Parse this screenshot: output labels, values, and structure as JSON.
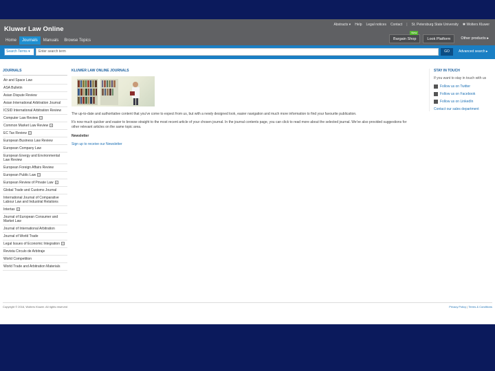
{
  "header": {
    "logo": "Kluwer Law Online",
    "nav_tabs": [
      "Home",
      "Journals",
      "Manuals",
      "Browse Topics"
    ],
    "active_tab": "Journals",
    "util_links": [
      "Abstracts ▾",
      "Help",
      "Legal notices",
      "Contact"
    ],
    "institution": "St. Petersburg State University",
    "publisher_logo": "Wolters Kluwer",
    "bargain_shop": "Bargain Shop",
    "new_badge": "New",
    "look_platform": "Look Platform",
    "other_products": "Other products ▸"
  },
  "search": {
    "scope": "Search Terms ▾",
    "placeholder": "Enter search term",
    "go": "GO",
    "advanced": "Advanced search ▸"
  },
  "sidebar": {
    "title": "JOURNALS",
    "items": [
      {
        "label": "Air and Space Law",
        "plus": false
      },
      {
        "label": "ASA Bulletin",
        "plus": false
      },
      {
        "label": "Asian Dispute Review",
        "plus": false
      },
      {
        "label": "Asian International Arbitration Journal",
        "plus": false
      },
      {
        "label": "ICSID International Arbitration Review",
        "plus": false
      },
      {
        "label": "Computer Law Review",
        "plus": true
      },
      {
        "label": "Common Market Law Review",
        "plus": true
      },
      {
        "label": "EC Tax Review",
        "plus": true
      },
      {
        "label": "European Business Law Review",
        "plus": false
      },
      {
        "label": "European Company Law",
        "plus": false
      },
      {
        "label": "European Energy and Environmental Law Review",
        "plus": false
      },
      {
        "label": "European Foreign Affairs Review",
        "plus": false
      },
      {
        "label": "European Public Law",
        "plus": true
      },
      {
        "label": "European Review of Private Law",
        "plus": true
      },
      {
        "label": "Global Trade and Customs Journal",
        "plus": false
      },
      {
        "label": "International Journal of Comparative Labour Law and Industrial Relations",
        "plus": false
      },
      {
        "label": "Intertax",
        "plus": true
      },
      {
        "label": "Journal of European Consumer and Market Law",
        "plus": false
      },
      {
        "label": "Journal of International Arbitration",
        "plus": false
      },
      {
        "label": "Journal of World Trade",
        "plus": false
      },
      {
        "label": "Legal Issues of Economic Integration",
        "plus": true
      },
      {
        "label": "Revista Circulo de Arbitraje",
        "plus": false
      },
      {
        "label": "World Competition",
        "plus": false
      },
      {
        "label": "World Trade and Arbitration Materials",
        "plus": false
      }
    ]
  },
  "main": {
    "title": "KLUWER LAW ONLINE JOURNALS",
    "para1": "The up-to-date and authoritative content that you've come to expect from us, but with a newly designed look, easier navigation and much more information to find your favourite publication.",
    "para2": "It's now much quicker and easier to browse straight to the most recent article of your chosen journal. In the journal contents page, you can click to read more about the selected journal. We've also provided suggestions for other relevant articles on the same topic area.",
    "newsletter_heading": "Newsletter",
    "newsletter_link": "Sign up to receive our Newsletter"
  },
  "right": {
    "title": "STAY IN TOUCH",
    "text": "If you want to stay in touch with us",
    "socials": [
      {
        "icon": "twitter-icon",
        "label": "Follow us on Twitter"
      },
      {
        "icon": "facebook-icon",
        "label": "Follow us on Facebook"
      },
      {
        "icon": "linkedin-icon",
        "label": "Follow us on LinkedIn"
      }
    ],
    "contact": "Contact our sales department"
  },
  "footer": {
    "copyright": "Copyright © 2016, Wolters Kluwer. All rights reserved",
    "privacy": "Privacy Policy",
    "terms": "Terms & Conditions"
  },
  "colors": {
    "outer_bg": "#0b1a5c",
    "header_gray": "#5f6063",
    "search_blue": "#1a7fc4",
    "accent_green": "#58b832"
  }
}
